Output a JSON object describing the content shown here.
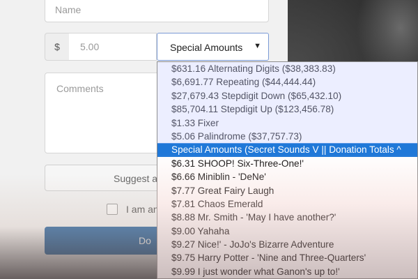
{
  "form": {
    "name_placeholder": "Name",
    "currency_symbol": "$",
    "amount_value": "5.00",
    "select_value": "Special Amounts",
    "select_arrow": "▼",
    "comments_placeholder": "Comments",
    "suggest_label": "Suggest a",
    "anon_label": "I am an",
    "donate_label": "Do"
  },
  "dropdown": {
    "options": [
      "$631.16 Alternating Digits ($38,383.83)",
      "$6,691.77 Repeating ($44,444.44)",
      "$27,679.43 Stepdigit Down ($65,432.10)",
      "$85,704.11 Stepdigit Up ($123,456.78)",
      "$1.33 Fixer",
      "$5.06 Palindrome ($37,757.73)",
      "Special Amounts (Secret Sounds V || Donation Totals ^",
      "$6.31 SHOOP! Six-Three-One!'",
      "$6.66 Miniblin - 'DeNe'",
      "$7.77 Great Fairy Laugh",
      "$7.81 Chaos Emerald",
      "$8.88 Mr. Smith - 'May I have another?'",
      "$9.00 Yahaha",
      "$9.27 Nice!' - JoJo's Bizarre Adventure",
      "$9.75 Harry Potter - 'Nine and Three-Quarters'",
      "$9.99 I just wonder what Ganon's up to!'"
    ],
    "selected_index": 6
  },
  "colors": {
    "selected_bg": "#1f78d8",
    "donate_bg": "#1f5f9e",
    "select_border": "#7a9ad6"
  }
}
